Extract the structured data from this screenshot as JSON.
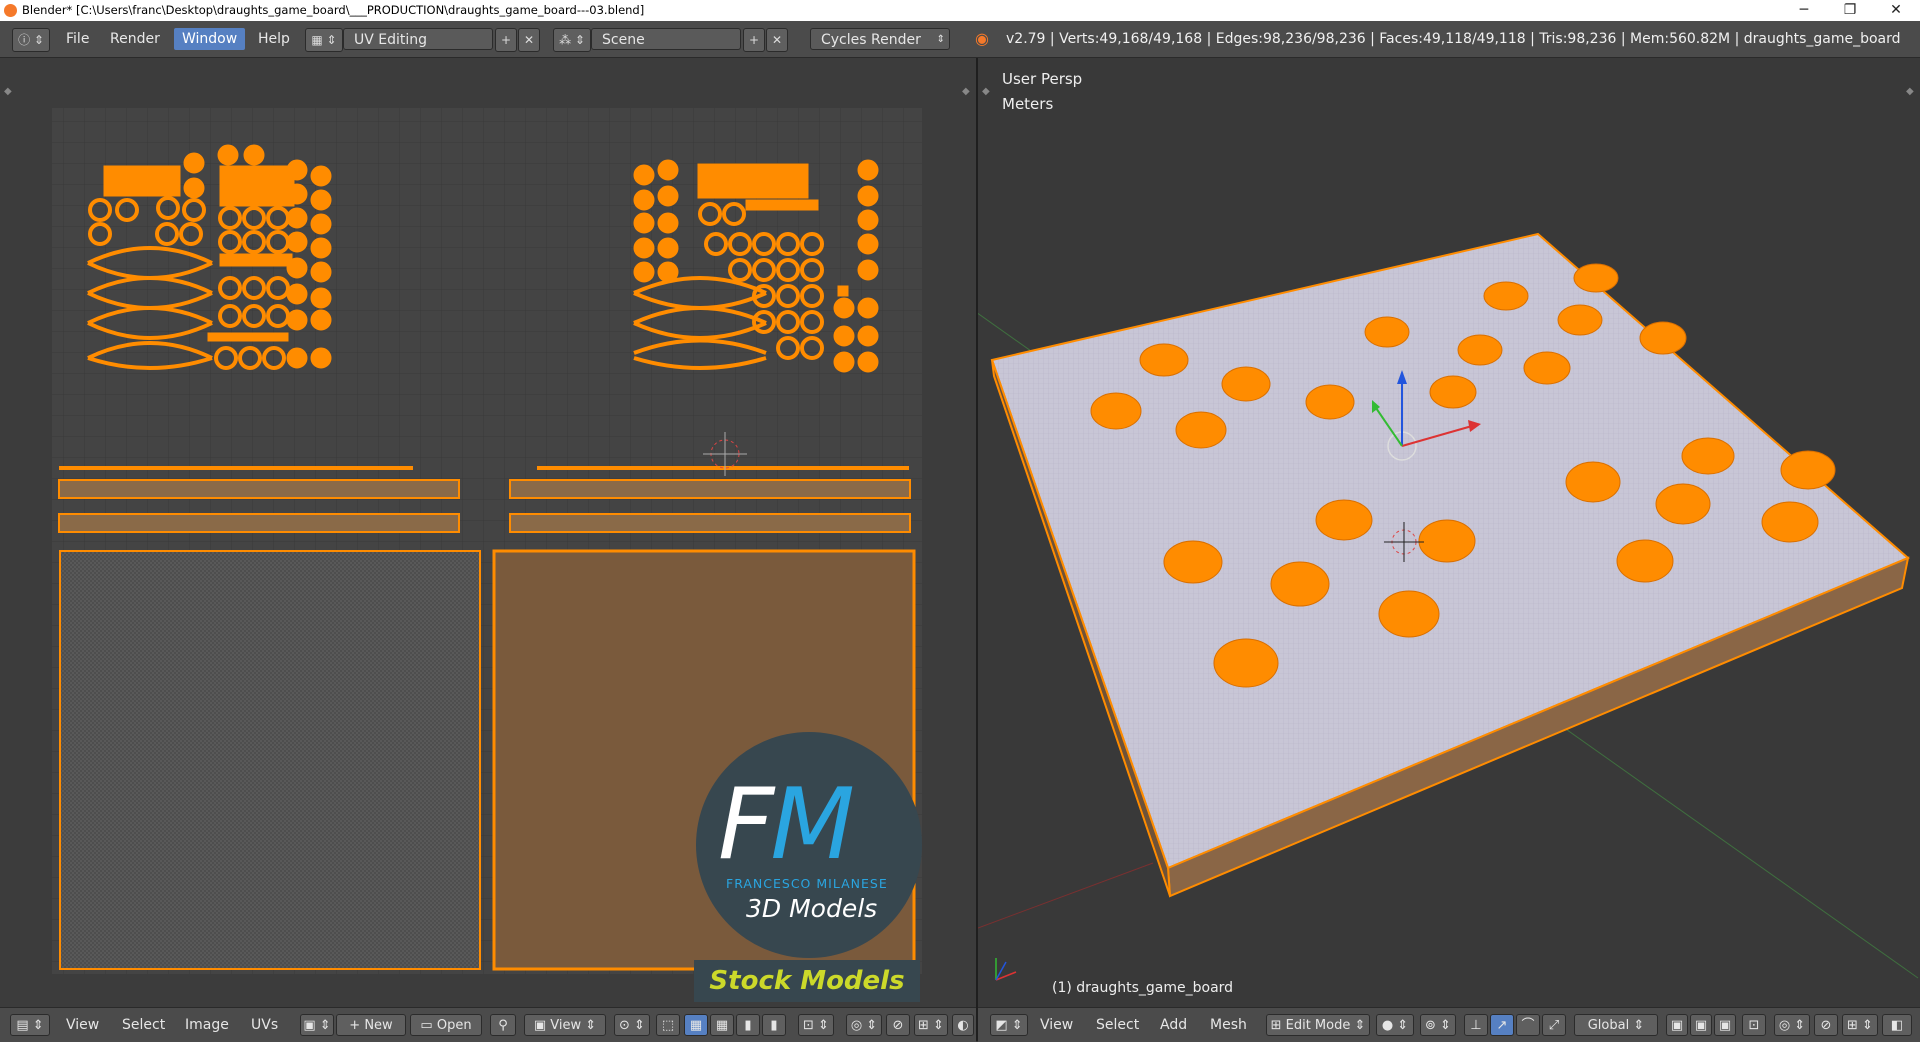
{
  "window": {
    "title": "Blender* [C:\\Users\\franc\\Desktop\\draughts_game_board\\___PRODUCTION\\draughts_game_board---03.blend]",
    "minimize": "─",
    "maximize": "❐",
    "close": "✕"
  },
  "menu": {
    "file": "File",
    "render": "Render",
    "window": "Window",
    "help": "Help"
  },
  "screen_layout": {
    "value": "UV Editing"
  },
  "scene": {
    "value": "Scene"
  },
  "render_engine": {
    "value": "Cycles Render"
  },
  "stats": "v2.79 | Verts:49,168/49,168 | Edges:98,236/98,236 | Faces:49,118/49,118 | Tris:98,236 | Mem:560.82M | draughts_game_board",
  "viewport": {
    "view_name": "User Persp",
    "units": "Meters",
    "object_label": "(1) draughts_game_board"
  },
  "uv_footer": {
    "view": "View",
    "select": "Select",
    "image": "Image",
    "uvs": "UVs",
    "new": "New",
    "open": "Open",
    "view2": "View"
  },
  "vp_footer": {
    "view": "View",
    "select": "Select",
    "add": "Add",
    "mesh": "Mesh",
    "mode": "Edit Mode",
    "orientation": "Global"
  },
  "watermark": {
    "initial_f": "F",
    "initial_m": "M",
    "name": "FRANCESCO MILANESE",
    "tagline": "3D Models",
    "badge": "Stock Models"
  },
  "colors": {
    "accent": "#5680c2",
    "selection": "#ff8c00",
    "board": "#c8c6d6",
    "wood": "#7a5a3c"
  }
}
